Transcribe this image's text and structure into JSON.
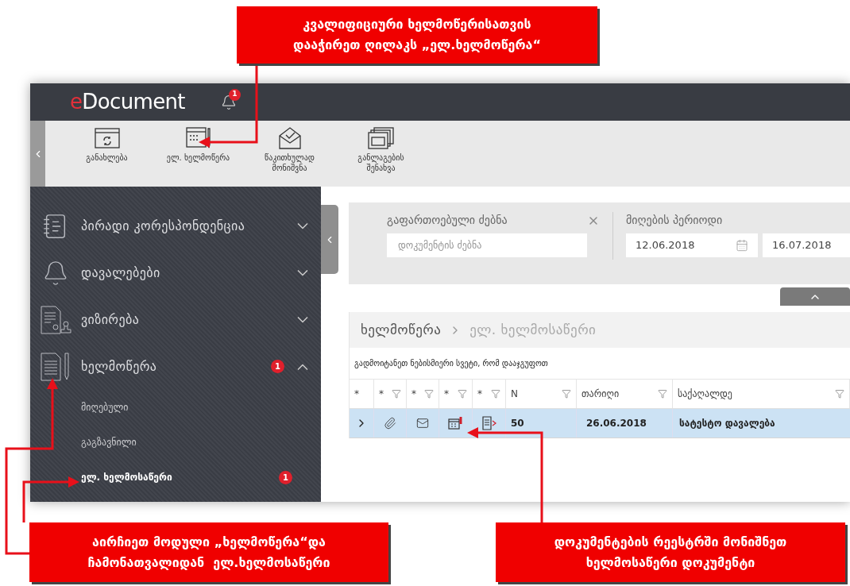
{
  "app": {
    "logo": {
      "accent": "e",
      "rest": "Document"
    },
    "notifications": "1",
    "toolbar": [
      {
        "label": "განახლება"
      },
      {
        "label": "ელ. ხელმოწერა"
      },
      {
        "label": "წაკითხულად მონიშვნა"
      },
      {
        "label": "განლაგების შენახვა"
      }
    ],
    "sidebar": [
      {
        "label": "პირადი კორესპონდენცია",
        "expanded": false
      },
      {
        "label": "დავალებები",
        "expanded": false
      },
      {
        "label": "ვიზირება",
        "expanded": false
      },
      {
        "label": "ხელმოწერა",
        "expanded": true,
        "badge": "1",
        "children": [
          {
            "label": "მიღებული",
            "selected": false
          },
          {
            "label": "გაგზავნილი",
            "selected": false
          },
          {
            "label": "ელ. ხელმოსაწერი",
            "selected": true,
            "badge": "1"
          }
        ]
      }
    ],
    "search": {
      "title": "გაფართოებული ძებნა",
      "placeholder": "დოკუმენტის ძებნა"
    },
    "period": {
      "title": "მიღების პერიოდი",
      "from": "12.06.2018",
      "to": "16.07.2018"
    },
    "breadcrumb": [
      {
        "label": "ხელმოწერა",
        "selected": false
      },
      {
        "label": "ელ. ხელმოსაწერი",
        "selected": true
      }
    ],
    "group_hint": "გადმოიტანეთ ნებისმიერი სვეტი, რომ დააჯგუფოთ",
    "table": {
      "columns": [
        {
          "label": "*",
          "filter": false
        },
        {
          "label": "*",
          "filter": true
        },
        {
          "label": "*",
          "filter": true
        },
        {
          "label": "*",
          "filter": true
        },
        {
          "label": "*",
          "filter": true
        },
        {
          "label": "N",
          "filter": true
        },
        {
          "label": "თარიღი",
          "filter": true
        },
        {
          "label": "საქაღალდე",
          "filter": true
        }
      ],
      "rows": [
        {
          "selected": true,
          "number": "50",
          "date": "26.06.2018",
          "folder": "სატესტო დავალება"
        }
      ]
    }
  },
  "callouts": [
    {
      "lines": [
        "კვალიფიციური ხელმოწერისათვის",
        "დააჭირეთ ღილაკს „ელ.ხელმოწერა“"
      ]
    },
    {
      "lines": [
        "აირჩიეთ მოდული „ხელმოწერა“და",
        "ჩამონათვალიდან  ელ.ხელმოსაწერი"
      ]
    },
    {
      "lines": [
        "დოკუმენტების რეესტრში მონიშნეთ",
        "ხელმოსაწერი დოკუმენტი"
      ]
    }
  ]
}
